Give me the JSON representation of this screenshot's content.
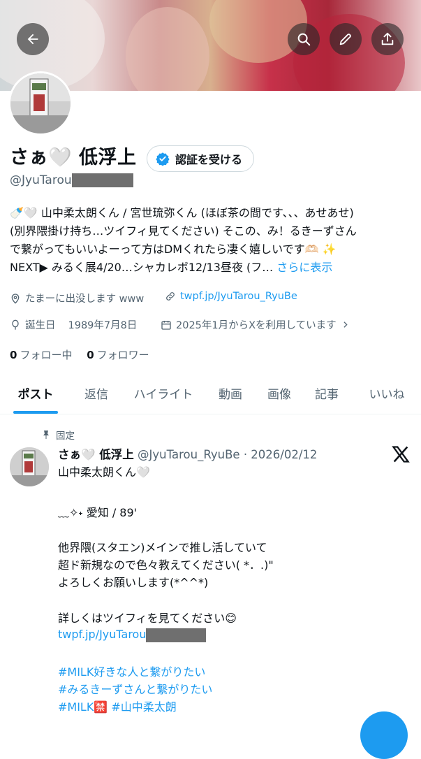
{
  "header": {
    "icons": [
      "back-arrow-icon",
      "search-icon",
      "pencil-icon",
      "share-icon"
    ]
  },
  "profile": {
    "name": "さぁ🤍 低浮上",
    "verify_label": "認証を受ける",
    "handle_prefix": "@JyuTarou",
    "bio_lines": [
      "🍼🤍 山中柔太朗くん / 宮世琉弥くん (ほぼ茶の間です、、、あせあせ)",
      "(別界隈掛け持ち…ツイフィ見てください) そこの、み！るきーずさん",
      "で繋がってもいいよーって方はDMくれたら凄く嬉しいです🫶🏻 ✨",
      "NEXT▶ みるく展4/20…シャカレボ12/13昼夜 (フ…"
    ],
    "see_more": "さらに表示",
    "location": "たまーに出没します www",
    "website": "twpf.jp/JyuTarou_RyuBe",
    "birthday_label": "誕生日",
    "birthday": "1989年7月8日",
    "joined": "2025年1月からXを利用しています",
    "following_count": "0",
    "following_label": "フォロー中",
    "followers_count": "0",
    "followers_label": "フォロワー"
  },
  "tabs": [
    {
      "label": "ポスト",
      "active": true
    },
    {
      "label": "返信",
      "active": false
    },
    {
      "label": "ハイライト",
      "active": false
    },
    {
      "label": "動画",
      "active": false
    },
    {
      "label": "画像",
      "active": false
    },
    {
      "label": "記事",
      "active": false
    },
    {
      "label": "いいね",
      "active": false
    }
  ],
  "post": {
    "pinned_label": "固定",
    "name": "さぁ🤍 低浮上",
    "handle_date": "@JyuTarou_RyuBe · 2026/02/12",
    "lines": [
      "山中柔太朗くん🤍",
      "﹏✧˖ 愛知 / 89'",
      "他界隈(スタエン)メインで推し活していて",
      "超ド新規なので色々教えてください( *．.)\"",
      "よろしくお願いします(*^^*)",
      "詳しくはツイフィを見てください😊",
      "twpf.jp/JyuTarou"
    ],
    "hashtags": [
      "#MILK好きな人と繋がりたい",
      "#みるきーずさんと繋がりたい",
      "#MILK🈲 #山中柔太朗"
    ]
  },
  "colors": {
    "accent": "#1d9bf0",
    "text": "#0f1419",
    "muted": "#536471",
    "border": "#cfd9de"
  }
}
